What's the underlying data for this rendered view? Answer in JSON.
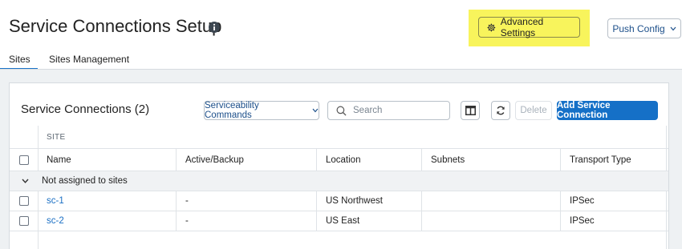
{
  "header": {
    "title": "Service Connections Setup",
    "info_icon": "info-icon",
    "advanced_settings_label": "Advanced Settings",
    "advanced_settings_icon": "gear-icon",
    "push_config_label": "Push Config",
    "highlight_color": "#f8f45c"
  },
  "tabs": [
    {
      "label": "Sites",
      "active": true
    },
    {
      "label": "Sites Management",
      "active": false
    }
  ],
  "card": {
    "title": "Service Connections (2)",
    "serviceability_label": "Serviceability Commands",
    "search_placeholder": "Search",
    "delete_label": "Delete",
    "add_label": "Add Service Connection",
    "accent_color": "#1570c7"
  },
  "table": {
    "group_header": "SITE",
    "columns": [
      "Name",
      "Active/Backup",
      "Location",
      "Subnets",
      "Transport Type"
    ],
    "group_label": "Not assigned to sites",
    "rows": [
      {
        "name": "sc-1",
        "active_backup": "-",
        "location": "US Northwest",
        "subnets": "",
        "transport": "IPSec"
      },
      {
        "name": "sc-2",
        "active_backup": "-",
        "location": "US East",
        "subnets": "",
        "transport": "IPSec"
      }
    ]
  }
}
